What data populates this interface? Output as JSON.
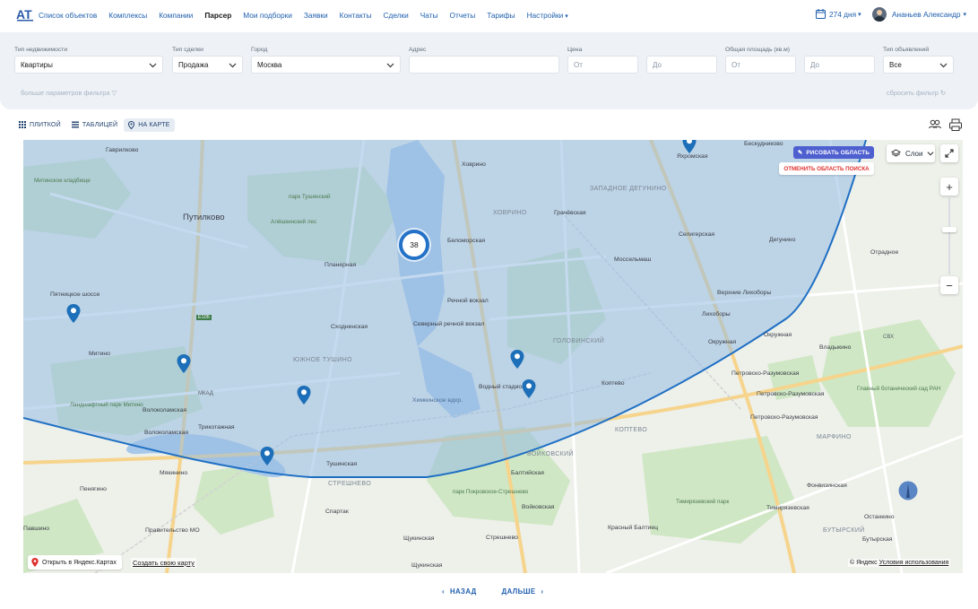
{
  "nav": {
    "logo_text": "AT REALTY",
    "items": [
      {
        "label": "Список объектов",
        "active": false
      },
      {
        "label": "Комплексы",
        "active": false
      },
      {
        "label": "Компании",
        "active": false
      },
      {
        "label": "Парсер",
        "active": true
      },
      {
        "label": "Мои подборки",
        "active": false
      },
      {
        "label": "Заявки",
        "active": false
      },
      {
        "label": "Контакты",
        "active": false
      },
      {
        "label": "Сделки",
        "active": false
      },
      {
        "label": "Чаты",
        "active": false
      },
      {
        "label": "Отчеты",
        "active": false
      },
      {
        "label": "Тарифы",
        "active": false
      }
    ],
    "settings_label": "Настройки",
    "days_label": "274 дня",
    "user_name": "Ананьев Александр"
  },
  "filters": {
    "property_type": {
      "label": "Тип недвижимости",
      "value": "Квартиры"
    },
    "deal_type": {
      "label": "Тип сделки",
      "value": "Продажа"
    },
    "city": {
      "label": "Город",
      "value": "Москва"
    },
    "address": {
      "label": "Адрес",
      "value": ""
    },
    "price": {
      "label": "Цена",
      "from_placeholder": "От",
      "to_placeholder": "До"
    },
    "area": {
      "label": "Общая площадь (кв.м)",
      "from_placeholder": "От",
      "to_placeholder": "До"
    },
    "listing_type": {
      "label": "Тип объявлений",
      "value": "Все"
    },
    "more_label": "больше параметров фильтра",
    "reset_label": "сбросить фильтр"
  },
  "views": {
    "tiles": "ПЛИТКОЙ",
    "table": "ТАБЛИЦЕЙ",
    "map": "НА КАРТЕ",
    "active": "map"
  },
  "map": {
    "cluster_count": "38",
    "draw_area": "РИСОВАТЬ ОБЛАСТЬ",
    "cancel_area": "ОТМЕНИТЬ ОБЛАСТЬ ПОИСКА",
    "layers": "Слои",
    "open_yandex": "Открыть в Яндекс.Картах",
    "create_map": "Создать свою карту",
    "copyright": "© Яндекс",
    "terms": "Условия использования",
    "labels": {
      "gavrilkovo": "Гаврилково",
      "mitino_cemetery": "Митинское кладбище",
      "putilkovo": "Путилково",
      "park_tushino": "парк Тушинский",
      "aleshkin": "Алёшкинский лес",
      "planernaya": "Планерная",
      "skhodnenskaya": "Сходненская",
      "pyatnitskoe": "Пятницкое шоссе",
      "mitino": "Митино",
      "south_tushino": "ЮЖНОЕ ТУШИНО",
      "landscape_park": "Ландшафтный парк Митино",
      "volokolamskaya": "Волоколамская",
      "trikotazhnaya": "Трикотажная",
      "volokolamskaya2": "Волоколамская",
      "myakinino": "Мякинино",
      "penyagino": "Пенягино",
      "pravitelstvo": "Правительство МО",
      "pavshino": "Павшино",
      "tushinskaya": "Тушинская",
      "streshnevo": "СТРЕШНЕВО",
      "spartak": "Спартак",
      "shchukinskaya": "Щукинская",
      "shchukinskaya2": "Щукинская",
      "khovrino": "Ховрино",
      "khovrino_dist": "ХОВРИНО",
      "belomorskaya": "Беломорская",
      "rechnoy": "Речной вокзал",
      "north_river": "Северный речной вокзал",
      "khimki": "Химкинское вдхр.",
      "vodny": "Водный стадион",
      "golovinsky": "ГОЛОВИНСКИЙ",
      "koptevo": "Коптево",
      "koptevo_dist": "КОПТЕВО",
      "voikovsky": "ВОЙКОВСКИЙ",
      "baltiyskaya": "Балтийская",
      "voykovskaya": "Войковская",
      "park_pokrov": "парк Покровское-Стрешнево",
      "streshnevo_st": "Стрешнево",
      "krasny_baltiets": "Красный Балтиец",
      "timiryazev_park": "Тимирязевский парк",
      "timiryazevskaya": "Тимирязевская",
      "grachevskaya": "Грачёвская",
      "west_degunino": "ЗАПАДНОЕ ДЕГУНИНО",
      "yakhromskaya": "Яхромская",
      "seligerskaya": "Селигерская",
      "degunino": "Дегунино",
      "mosselmash": "Моссельмаш",
      "verkhnie": "Верхние Лихоборы",
      "likhobory": "Лихоборы",
      "okruzhnaya": "Окружная",
      "okruzhnaya2": "Окружная",
      "vladykino": "Владыкино",
      "petrovsko1": "Петровско-Разумовская",
      "petrovsko2": "Петровско-Разумовская",
      "petrovsko3": "Петровско-Разумовская",
      "botanic": "Главный ботанический сад РАН",
      "marfino": "МАРФИНО",
      "fonvizinskaya": "Фонвизинская",
      "butyrsky": "БУТЫРСКИЙ",
      "ostankino": "Останкино",
      "butyrskaya": "Бутырская",
      "beskudnikovo": "Бескудниково",
      "otradnoe": "Отрадное",
      "svh": "СВХ",
      "mkad": "МКАД",
      "e105": "E105"
    }
  },
  "pager": {
    "back": "НАЗАД",
    "next": "ДАЛЬШЕ"
  }
}
